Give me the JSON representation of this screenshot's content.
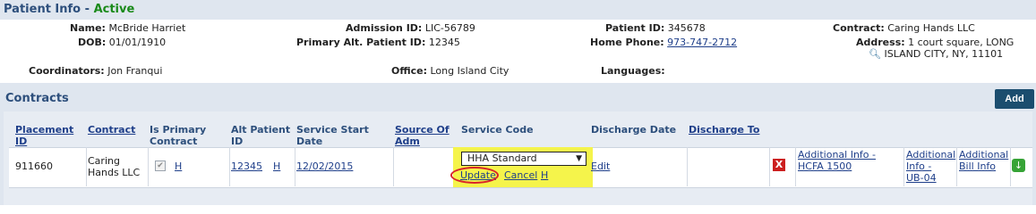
{
  "patient": {
    "title": "Patient Info",
    "status": "Active",
    "name_label": "Name:",
    "name_value": "McBride Harriet",
    "dob_label": "DOB:",
    "dob_value": "01/01/1910",
    "coordinators_label": "Coordinators:",
    "coordinators_value": "Jon Franqui",
    "admission_label": "Admission ID:",
    "admission_value": "LIC-56789",
    "alt_id_label": "Primary Alt. Patient ID:",
    "alt_id_value": "12345",
    "office_label": "Office:",
    "office_value": "Long Island City",
    "patient_id_label": "Patient ID:",
    "patient_id_value": "345678",
    "phone_label": "Home Phone:",
    "phone_value": "973-747-2712",
    "languages_label": "Languages:",
    "languages_value": "",
    "contract_label": "Contract:",
    "contract_value": "Caring Hands LLC",
    "address_label": "Address:",
    "address_line1": "1 court square, LONG",
    "address_line2": "ISLAND CITY, NY, 11101"
  },
  "contracts": {
    "title": "Contracts",
    "add_label": "Add",
    "headers": {
      "placement_id_1": "Placement",
      "placement_id_2": "ID",
      "contract": "Contract",
      "is_primary_1": "Is Primary",
      "is_primary_2": "Contract",
      "alt_patient_1": "Alt Patient",
      "alt_patient_2": "ID",
      "service_start_1": "Service Start",
      "service_start_2": "Date",
      "source_adm_1": "Source Of",
      "source_adm_2": "Adm",
      "service_code": "Service Code",
      "discharge_date": "Discharge Date",
      "discharge_to": "Discharge To"
    },
    "row": {
      "placement_id": "911660",
      "contract_1": "Caring",
      "contract_2": "Hands LLC",
      "primary_history": "H",
      "alt_patient_id": "12345",
      "alt_history": "H",
      "service_start": "12/02/2015",
      "service_code_selected": "HHA Standard",
      "update_label": "Update",
      "cancel_label": "Cancel",
      "code_history": "H",
      "edit_label": "Edit",
      "delete_glyph": "X",
      "info_hcfa_1": "Additional Info -",
      "info_hcfa_2": "HCFA 1500",
      "info_ub_1": "Additional",
      "info_ub_2": "Info -",
      "info_ub_3": "UB-04",
      "bill_1": "Additional",
      "bill_2": "Bill Info"
    }
  },
  "colors": {
    "header_bg": "#dfe6ef",
    "title_text": "#2d4f7c",
    "status_green": "#1a8a1a",
    "link": "#1f3f8a",
    "highlight_yellow": "#f5f44b",
    "annotation_red": "#d8232a",
    "add_button": "#1b4d6e"
  },
  "icons": {
    "map": "map-icon",
    "check": "checkbox-icon",
    "delete": "delete-icon",
    "download": "download-icon",
    "dropdown": "chevron-down-icon"
  }
}
